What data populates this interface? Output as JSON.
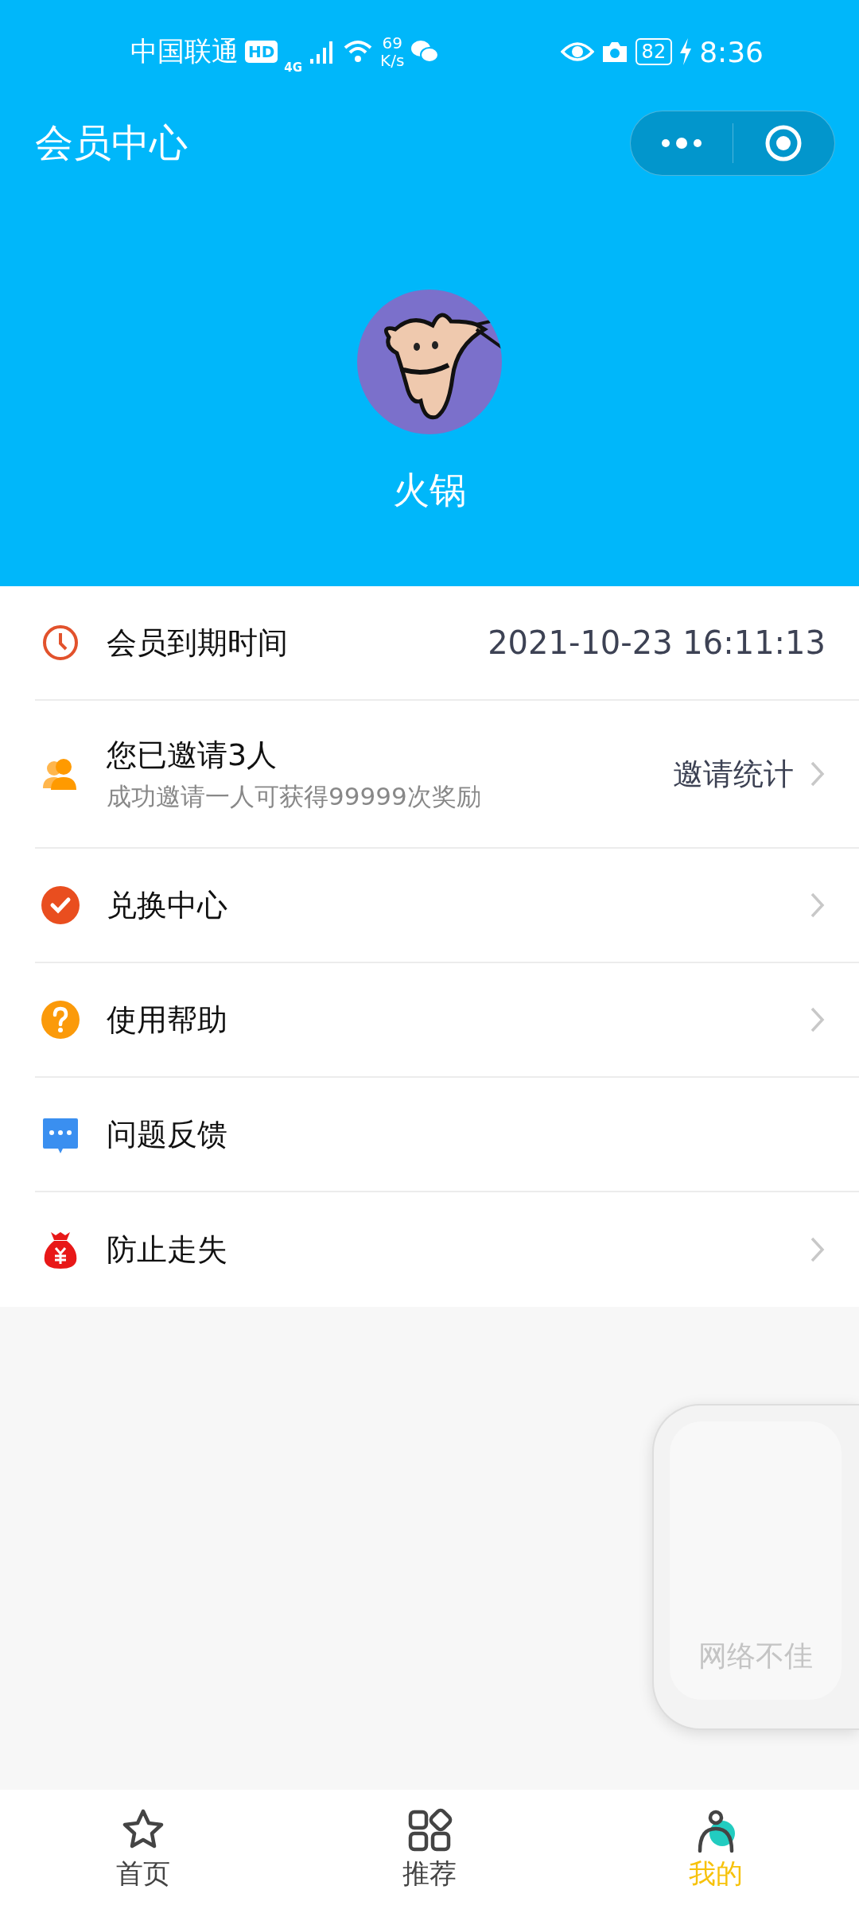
{
  "status_bar": {
    "carrier": "中国联通",
    "hd": "HD",
    "network": "4G",
    "speed": "69",
    "speed_unit": "K/s",
    "battery": "82",
    "time": "8:36"
  },
  "title_bar": {
    "title": "会员中心"
  },
  "profile": {
    "name": "火锅"
  },
  "menu": [
    {
      "kind": "value",
      "title": "会员到期时间",
      "value": "2021-10-23 16:11:13",
      "chevron": false
    },
    {
      "kind": "invite",
      "title": "您已邀请3人",
      "subtitle": "成功邀请一人可获得99999次奖励",
      "link": "邀请统计",
      "chevron": true
    },
    {
      "kind": "nav",
      "title": "兑换中心",
      "chevron": true
    },
    {
      "kind": "nav",
      "title": "使用帮助",
      "chevron": true
    },
    {
      "kind": "nav",
      "title": "问题反馈",
      "chevron": false
    },
    {
      "kind": "nav",
      "title": "防止走失",
      "chevron": true
    }
  ],
  "float_panel": {
    "message": "网络不佳"
  },
  "tabs": [
    {
      "label": "首页",
      "selected": false
    },
    {
      "label": "推荐",
      "selected": false
    },
    {
      "label": "我的",
      "selected": true
    }
  ]
}
